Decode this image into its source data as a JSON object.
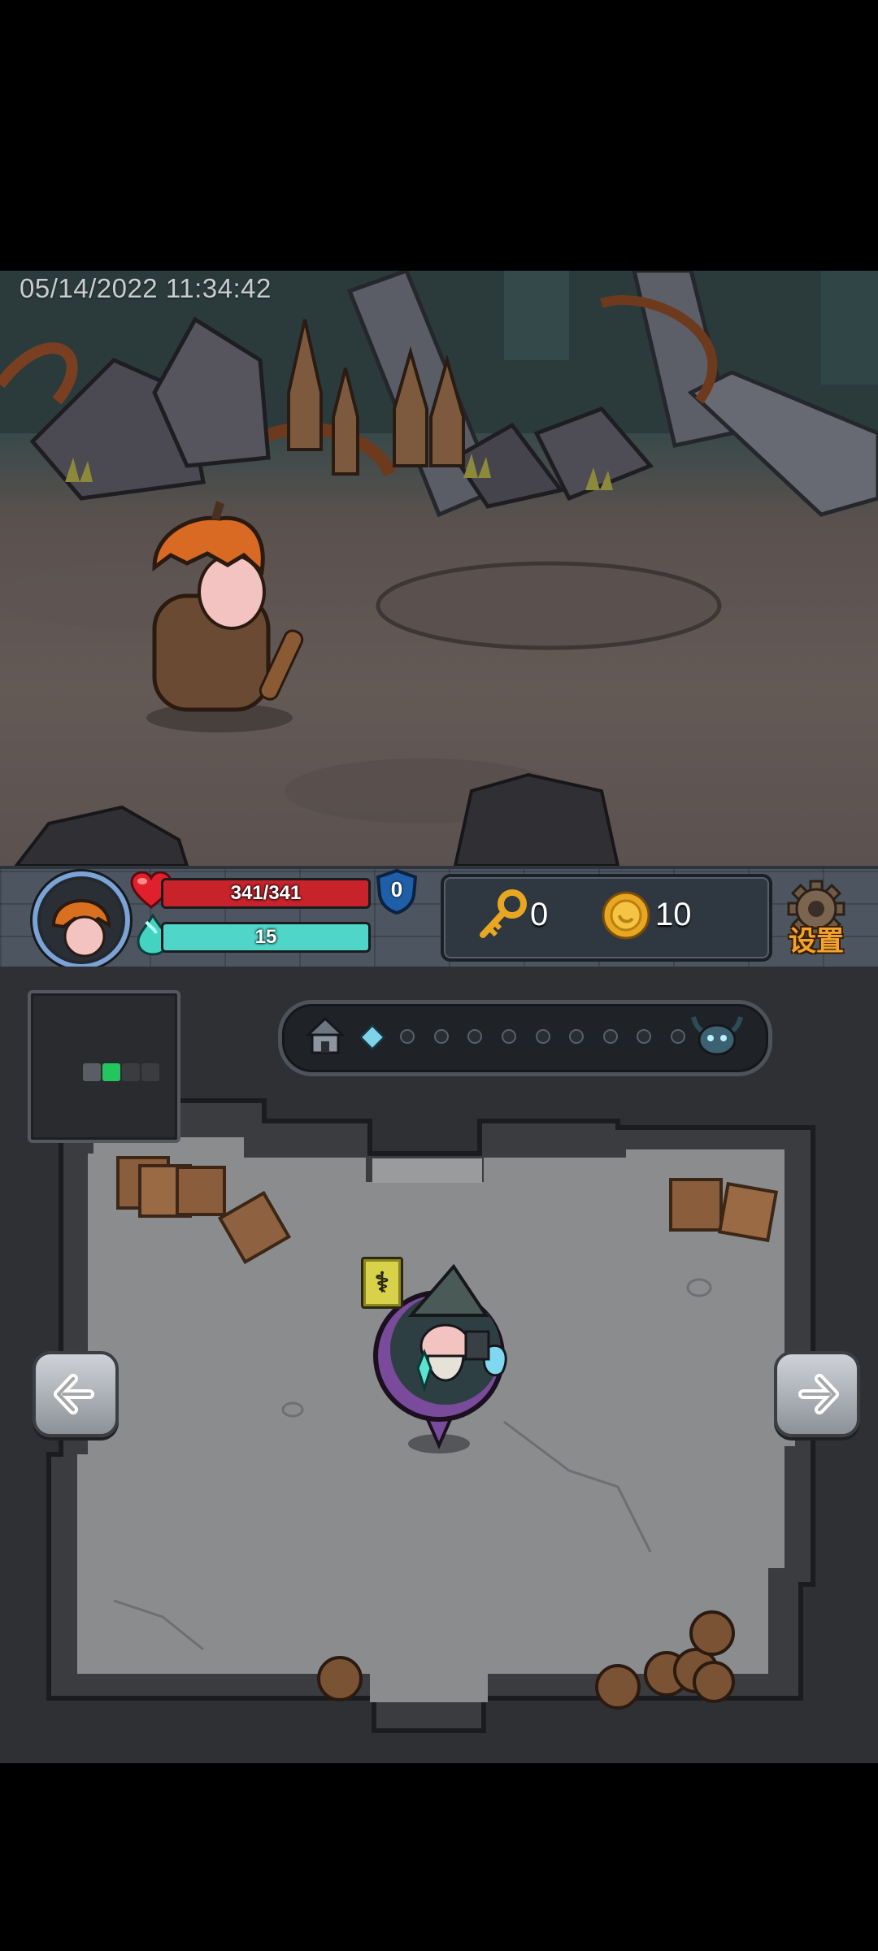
{
  "scene": {
    "timestamp": "05/14/2022 11:34:42"
  },
  "hud": {
    "hp": {
      "current": 341,
      "max": 341,
      "label": "341/341",
      "fill_fraction": 1.0
    },
    "mana": {
      "label": "15",
      "fill_fraction": 1.0
    },
    "shield": {
      "label": "0"
    },
    "keys": {
      "count": "0"
    },
    "coins": {
      "count": "10"
    },
    "settings_label": "设置"
  },
  "map": {
    "progress": {
      "total_stops": 11,
      "current_stop": 1,
      "start_icon": "house-icon",
      "end_icon": "boss-demon-icon"
    },
    "minimap_rooms": 4,
    "minimap_current_room": 1
  },
  "colors": {
    "hp_fill": "#c8232b",
    "mana_fill": "#4fd6c8",
    "shield": "#1f5fa8",
    "minimap_current": "#22c55e",
    "minimap_room": "#5a5d63",
    "gold": "#e8a722",
    "settings_text": "#f3a22a"
  }
}
